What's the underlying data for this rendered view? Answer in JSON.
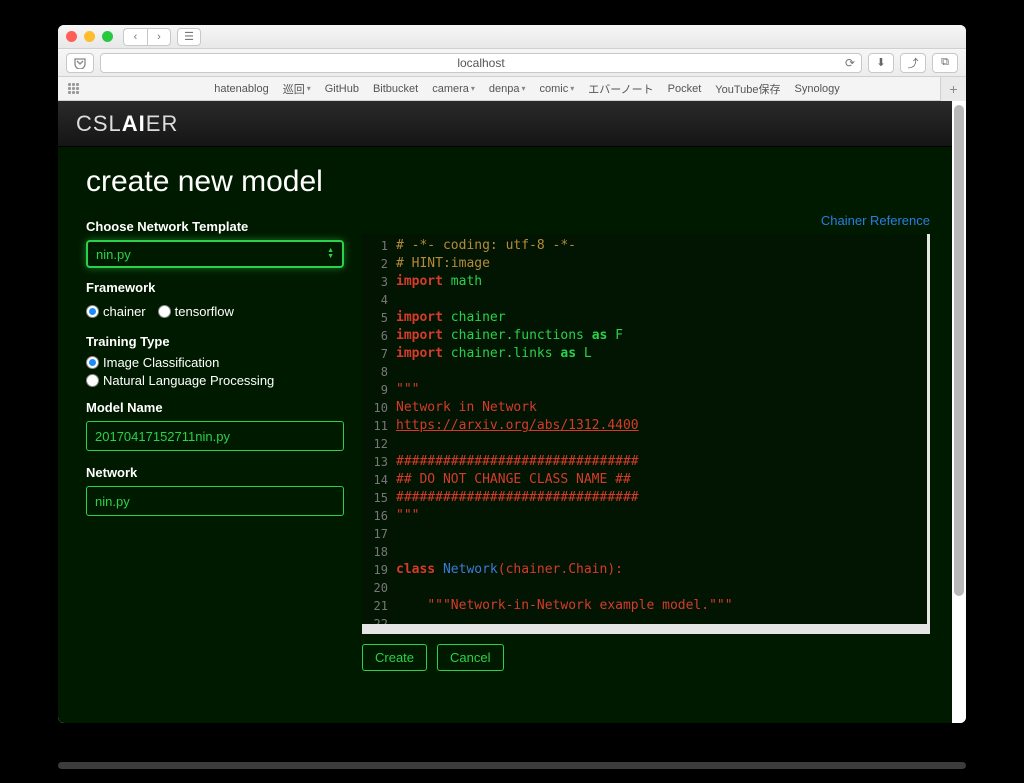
{
  "browser": {
    "address": "localhost",
    "toolbar_icons": {
      "back": "‹",
      "forward": "›",
      "sidebar": "☰",
      "reload": "⟳",
      "download": "⬇",
      "share": "⤴",
      "tabs": "⧉"
    }
  },
  "bookmarks": {
    "items": [
      {
        "label": "hatenablog",
        "dropdown": false
      },
      {
        "label": "巡回",
        "dropdown": true
      },
      {
        "label": "GitHub",
        "dropdown": false
      },
      {
        "label": "Bitbucket",
        "dropdown": false
      },
      {
        "label": "camera",
        "dropdown": true
      },
      {
        "label": "denpa",
        "dropdown": true
      },
      {
        "label": "comic",
        "dropdown": true
      },
      {
        "label": "エバーノート",
        "dropdown": false
      },
      {
        "label": "Pocket",
        "dropdown": false
      },
      {
        "label": "YouTube保存",
        "dropdown": false
      },
      {
        "label": "Synology",
        "dropdown": false
      }
    ],
    "new_tab": "+"
  },
  "app": {
    "logo_pre": "CSL",
    "logo_bold": "AI",
    "logo_post": "ER",
    "title": "create new model",
    "reference_link": "Chainer Reference",
    "labels": {
      "template": "Choose Network Template",
      "framework": "Framework",
      "training_type": "Training Type",
      "model_name": "Model Name",
      "network": "Network"
    },
    "template_select": "nin.py",
    "framework_options": [
      {
        "label": "chainer",
        "checked": true
      },
      {
        "label": "tensorflow",
        "checked": false
      }
    ],
    "training_options": [
      {
        "label": "Image Classification",
        "checked": true
      },
      {
        "label": "Natural Language Processing",
        "checked": false
      }
    ],
    "model_name": "20170417152711nin.py",
    "network": "nin.py",
    "buttons": {
      "create": "Create",
      "cancel": "Cancel"
    }
  },
  "chart_data": {
    "type": "table",
    "title": "code editor contents",
    "lines": [
      {
        "n": 1,
        "tokens": [
          [
            "comment",
            "# -*- coding: utf-8 -*-"
          ]
        ]
      },
      {
        "n": 2,
        "tokens": [
          [
            "comment",
            "# HINT:image"
          ]
        ]
      },
      {
        "n": 3,
        "tokens": [
          [
            "kw",
            "import "
          ],
          [
            "mod",
            "math"
          ]
        ]
      },
      {
        "n": 4,
        "tokens": []
      },
      {
        "n": 5,
        "tokens": [
          [
            "kw",
            "import "
          ],
          [
            "mod",
            "chainer"
          ]
        ]
      },
      {
        "n": 6,
        "tokens": [
          [
            "kw",
            "import "
          ],
          [
            "mod",
            "chainer.functions "
          ],
          [
            "as",
            "as "
          ],
          [
            "mod",
            "F"
          ]
        ]
      },
      {
        "n": 7,
        "tokens": [
          [
            "kw",
            "import "
          ],
          [
            "mod",
            "chainer.links "
          ],
          [
            "as",
            "as "
          ],
          [
            "mod",
            "L"
          ]
        ]
      },
      {
        "n": 8,
        "tokens": []
      },
      {
        "n": 9,
        "tokens": [
          [
            "str",
            "\"\"\""
          ]
        ]
      },
      {
        "n": 10,
        "tokens": [
          [
            "text",
            "Network in Network"
          ]
        ]
      },
      {
        "n": 11,
        "tokens": [
          [
            "url",
            "https://arxiv.org/abs/1312.4400"
          ]
        ]
      },
      {
        "n": 12,
        "tokens": []
      },
      {
        "n": 13,
        "tokens": [
          [
            "hash",
            "###############################"
          ]
        ]
      },
      {
        "n": 14,
        "tokens": [
          [
            "hash",
            "## DO NOT CHANGE CLASS NAME ##"
          ]
        ]
      },
      {
        "n": 15,
        "tokens": [
          [
            "hash",
            "###############################"
          ]
        ]
      },
      {
        "n": 16,
        "tokens": [
          [
            "str",
            "\"\"\""
          ]
        ]
      },
      {
        "n": 17,
        "tokens": []
      },
      {
        "n": 18,
        "tokens": []
      },
      {
        "n": 19,
        "tokens": [
          [
            "kw",
            "class "
          ],
          [
            "class",
            "Network"
          ],
          [
            "name",
            "(chainer.Chain):"
          ]
        ]
      },
      {
        "n": 20,
        "tokens": []
      },
      {
        "n": 21,
        "tokens": [
          [
            "plain",
            "    "
          ],
          [
            "str",
            "\"\"\"Network-in-Network example model.\"\"\""
          ]
        ]
      },
      {
        "n": 22,
        "tokens": []
      }
    ]
  }
}
